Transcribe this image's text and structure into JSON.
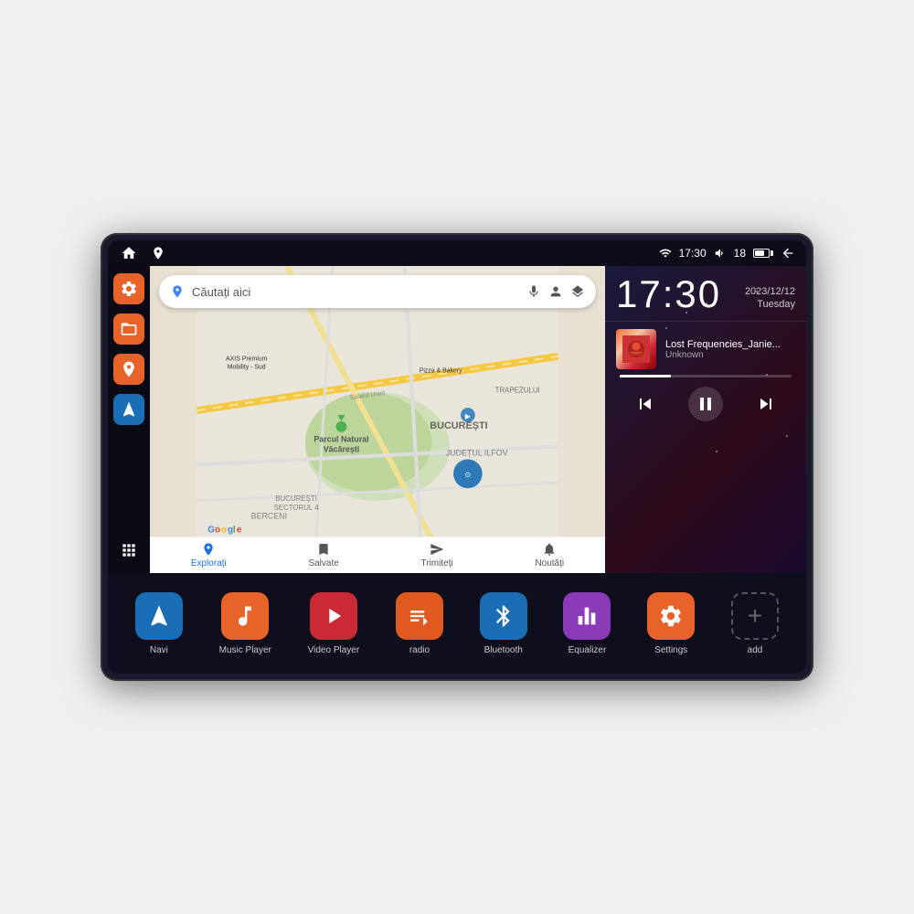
{
  "device": {
    "status_bar": {
      "time": "17:30",
      "battery_level": "18",
      "signal_icon": "▼",
      "volume_icon": "🔊"
    },
    "sidebar": {
      "items": [
        {
          "id": "settings",
          "label": "Settings",
          "icon": "⚙",
          "color": "orange"
        },
        {
          "id": "files",
          "label": "Files",
          "icon": "📁",
          "color": "orange"
        },
        {
          "id": "maps",
          "label": "Maps",
          "icon": "📍",
          "color": "orange"
        },
        {
          "id": "navi",
          "label": "Navigation",
          "icon": "▲",
          "color": "blue"
        },
        {
          "id": "grid",
          "label": "All Apps",
          "icon": "⋯",
          "color": "transparent"
        }
      ]
    },
    "map": {
      "search_placeholder": "Căutați aici",
      "location": "București",
      "labels": [
        "Parcul Natural Văcărești",
        "BUCUREȘTI",
        "JUDEȚUL ILFOV",
        "BERCENI",
        "BUCUREȘTI SECTORUL 4",
        "AXIS Premium Mobility - Sud",
        "Pizza & Bakery",
        "TRAPEZULUI"
      ],
      "bottom_items": [
        {
          "label": "Explorați",
          "icon": "🔍",
          "active": true
        },
        {
          "label": "Salvate",
          "icon": "🔖",
          "active": false
        },
        {
          "label": "Trimiteți",
          "icon": "↗",
          "active": false
        },
        {
          "label": "Noutăți",
          "icon": "🔔",
          "active": false
        }
      ]
    },
    "clock": {
      "time": "17:30",
      "date": "2023/12/12",
      "day": "Tuesday"
    },
    "music": {
      "title": "Lost Frequencies_Janie...",
      "artist": "Unknown",
      "progress": 30
    },
    "apps": [
      {
        "id": "navi",
        "label": "Navi",
        "icon": "▲",
        "color": "#1a6eb5"
      },
      {
        "id": "music",
        "label": "Music Player",
        "icon": "♪",
        "color": "#e8632a"
      },
      {
        "id": "video",
        "label": "Video Player",
        "icon": "▶",
        "color": "#cc2936"
      },
      {
        "id": "radio",
        "label": "radio",
        "icon": "📻",
        "color": "#e05a20"
      },
      {
        "id": "bluetooth",
        "label": "Bluetooth",
        "icon": "Ƀ",
        "color": "#1a6eb5"
      },
      {
        "id": "equalizer",
        "label": "Equalizer",
        "icon": "⫸",
        "color": "#8b3ab8"
      },
      {
        "id": "settings",
        "label": "Settings",
        "icon": "⚙",
        "color": "#e8632a"
      },
      {
        "id": "add",
        "label": "add",
        "icon": "+",
        "color": "transparent"
      }
    ]
  }
}
